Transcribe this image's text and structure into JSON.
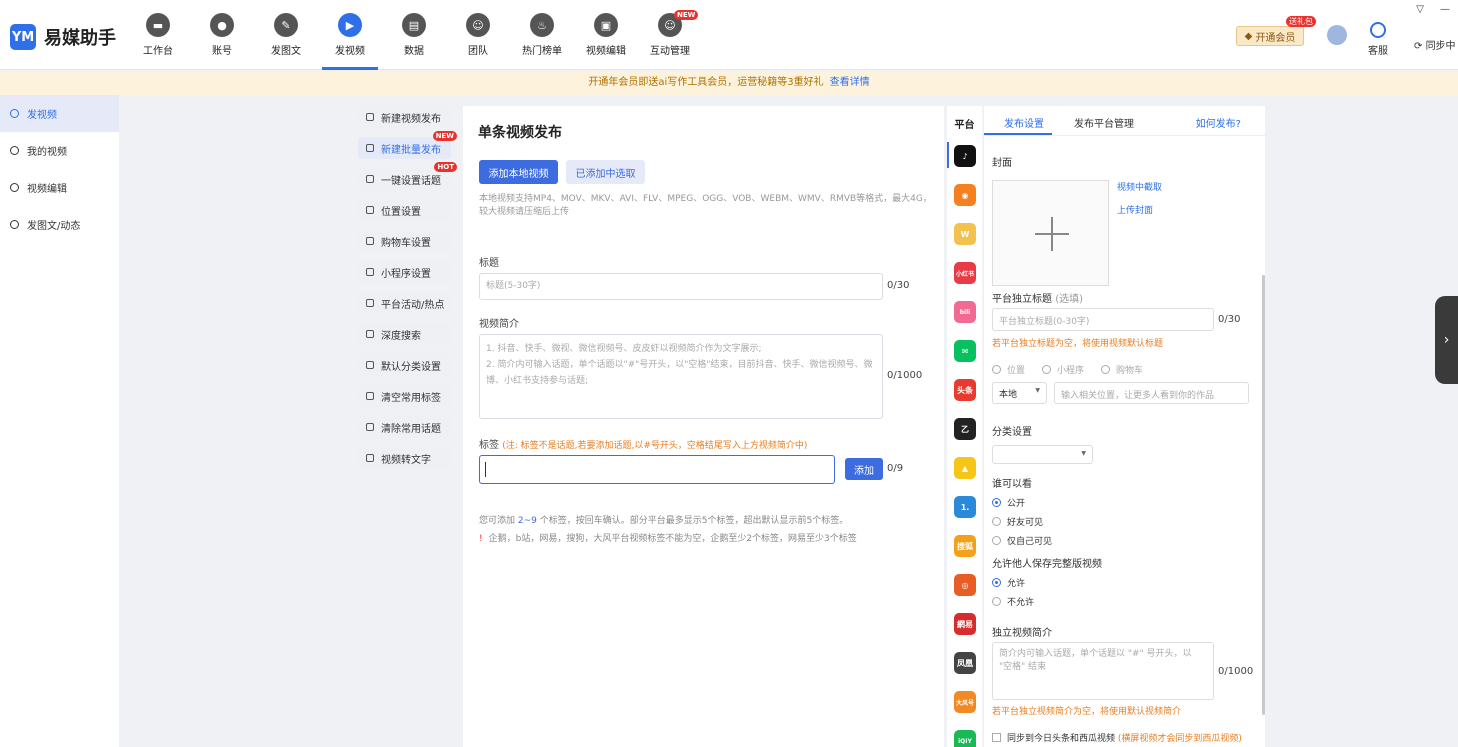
{
  "app": {
    "logo_mark": "YM",
    "name": "易媒助手"
  },
  "nav": {
    "items": [
      {
        "label": "工作台",
        "glyph": "▬"
      },
      {
        "label": "账号",
        "glyph": "●"
      },
      {
        "label": "发图文",
        "glyph": "✎"
      },
      {
        "label": "发视频",
        "glyph": "▶",
        "active": true
      },
      {
        "label": "数据",
        "glyph": "▤"
      },
      {
        "label": "团队",
        "glyph": "☺"
      },
      {
        "label": "热门榜单",
        "glyph": "♨"
      },
      {
        "label": "视频编辑",
        "glyph": "▣"
      },
      {
        "label": "互动管理",
        "glyph": "☺",
        "badge": "NEW"
      }
    ]
  },
  "header": {
    "vip_label": "开通会员",
    "vip_gift": "送礼包",
    "support_label": "客服",
    "sync_label": "同步中"
  },
  "banner": {
    "text": "开通年会员即送ai写作工具会员，运营秘籍等3重好礼",
    "link": "查看详情"
  },
  "leftnav": {
    "items": [
      {
        "label": "发视频",
        "active": true
      },
      {
        "label": "我的视频"
      },
      {
        "label": "视频编辑"
      },
      {
        "label": "发图文/动态"
      }
    ]
  },
  "submenu": {
    "items": [
      {
        "label": "新建视频发布"
      },
      {
        "label": "新建批量发布",
        "badge": "NEW",
        "active": true
      },
      {
        "label": "一键设置话题",
        "badge": "HOT"
      },
      {
        "label": "位置设置"
      },
      {
        "label": "购物车设置"
      },
      {
        "label": "小程序设置"
      },
      {
        "label": "平台活动/热点"
      },
      {
        "label": "深度搜索"
      },
      {
        "label": "默认分类设置"
      },
      {
        "label": "清空常用标签"
      },
      {
        "label": "清除常用话题"
      },
      {
        "label": "视频转文字"
      }
    ]
  },
  "main": {
    "title": "单条视频发布",
    "add_local_btn": "添加本地视频",
    "select_added_btn": "已添加中选取",
    "format_hint": "本地视频支持MP4、MOV、MKV、AVI、FLV、MPEG、OGG、VOB、WEBM、WMV、RMVB等格式，最大4G，较大视频请压缩后上传",
    "title_label": "标题",
    "title_placeholder": "标题(5-30字)",
    "title_counter": "0/30",
    "desc_label": "视频简介",
    "desc_placeholder_1": "1. 抖音、快手、微视、微信视频号、皮皮虾以视频简介作为文字展示;",
    "desc_placeholder_2": "2. 简介内可输入话题，单个话题以\"#\"号开头，以\"空格\"结束，目前抖音、快手、微信视频号、微博、小红书支持参与话题;",
    "desc_counter": "0/1000",
    "tag_label": "标签",
    "tag_note": "(注: 标签不是话题,若要添加话题,以#号开头，空格结尾写入上方视频简介中)",
    "add_btn": "添加",
    "tag_counter": "0/9",
    "tip_prefix": "您可添加",
    "tip_range": "2~9",
    "tip_suffix": "个标签，按回车确认。部分平台最多显示5个标签，超出默认显示前5个标签。",
    "tip_warn_icon": "!",
    "tip_warn": "企鹅，b站，网易，搜狗，大风平台视频标签不能为空，企鹅至少2个标签，网易至少3个标签"
  },
  "platforms": {
    "title": "平台",
    "items": [
      {
        "name": "douyin-icon",
        "glyph": "♪",
        "color": "#111111"
      },
      {
        "name": "kuaishou-icon",
        "glyph": "◉",
        "color": "#f5801f"
      },
      {
        "name": "weishi-icon",
        "glyph": "W",
        "color": "#f2c14e"
      },
      {
        "name": "xiaohongshu-icon",
        "glyph": "小红书",
        "color": "#e93a45"
      },
      {
        "name": "bilibili-icon",
        "glyph": "bili",
        "color": "#f06a94"
      },
      {
        "name": "wechat-channels-icon",
        "glyph": "✉",
        "color": "#07c160"
      },
      {
        "name": "toutiao-icon",
        "glyph": "头条",
        "color": "#e93a2f"
      },
      {
        "name": "zhihu-icon",
        "glyph": "乙",
        "color": "#222222"
      },
      {
        "name": "qq-penguin-icon",
        "glyph": "▲",
        "color": "#f5c518"
      },
      {
        "name": "baijiahao-icon",
        "glyph": "1.",
        "color": "#2a8ad9"
      },
      {
        "name": "sohu-icon",
        "glyph": "搜狐",
        "color": "#f3a11b"
      },
      {
        "name": "weibo-icon",
        "glyph": "◎",
        "color": "#e85d24"
      },
      {
        "name": "netease-icon",
        "glyph": "網易",
        "color": "#d62c2c"
      },
      {
        "name": "fengxiang-icon",
        "glyph": "凤凰",
        "color": "#444444"
      },
      {
        "name": "dafeng-icon",
        "glyph": "大风号",
        "color": "#f08a24"
      },
      {
        "name": "iqiyi-icon",
        "glyph": "iQIY",
        "color": "#19b955"
      }
    ]
  },
  "settings": {
    "tab_publish": "发布设置",
    "tab_platform_mgmt": "发布平台管理",
    "help_link": "如何发布?",
    "cover_label": "封面",
    "cover_from_video": "视频中截取",
    "cover_upload": "上传封面",
    "indep_title_label": "平台独立标题",
    "indep_title_optional": "(选填)",
    "indep_title_placeholder": "平台独立标题(0-30字)",
    "indep_title_counter": "0/30",
    "indep_title_note": "若平台独立标题为空，将使用视频默认标题",
    "opt_location": "位置",
    "opt_miniprogram": "小程序",
    "opt_cart": "购物车",
    "location_select": "本地",
    "location_placeholder": "输入相关位置，让更多人看到你的作品",
    "category_label": "分类设置",
    "visibility_label": "谁可以看",
    "vis_public": "公开",
    "vis_friends": "好友可见",
    "vis_self": "仅自己可见",
    "save_label": "允许他人保存完整版视频",
    "save_allow": "允许",
    "save_deny": "不允许",
    "indep_desc_label": "独立视频简介",
    "indep_desc_placeholder": "简介内可输入话题，单个话题以 \"#\" 号开头，以 \"空格\" 结束",
    "indep_desc_counter": "0/1000",
    "indep_desc_note": "若平台独立视频简介为空，将使用默认视频简介",
    "sync_check_label": "同步到今日头条和西瓜视频",
    "sync_check_note": "(横屏视频才会同步到西瓜视频)"
  },
  "colors": {
    "accent": "#3d6be0",
    "warning": "#e67e22",
    "danger": "#e8322d"
  }
}
